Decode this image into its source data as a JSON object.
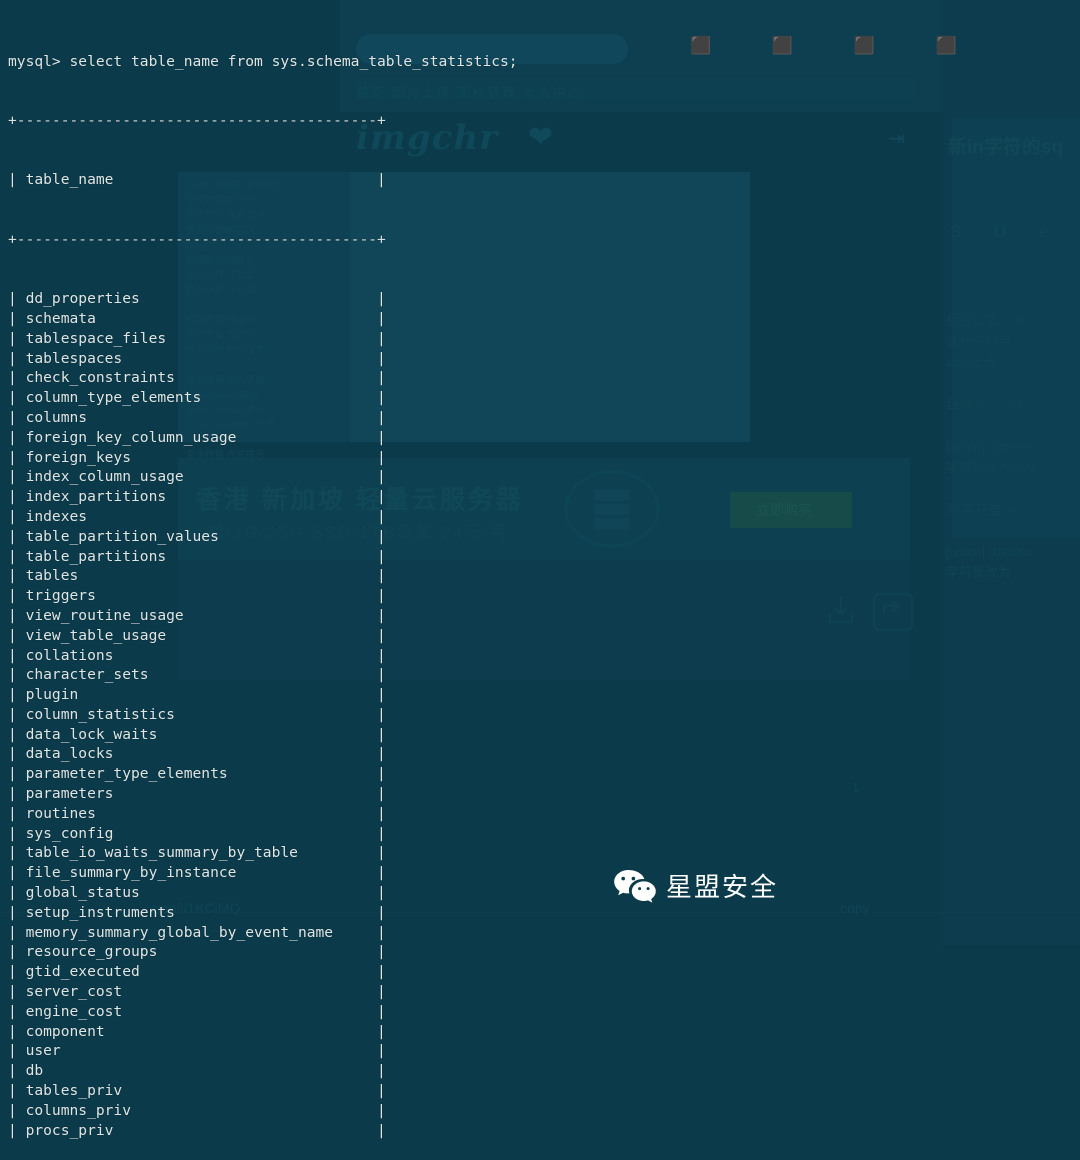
{
  "window": {
    "background_color": "#0b3a4a",
    "terminal_text_color": "#dfe6e6"
  },
  "terminal": {
    "prompt": "mysql>",
    "command": "select table_name from sys.schema_table_statistics;",
    "prompt_line": "mysql> select table_name from sys.schema_table_statistics;",
    "rule_top": "+-----------------------------------------+",
    "rule_mid": "+-----------------------------------------+",
    "column_header": "| table_name                              |",
    "column_name": "table_name",
    "rows": [
      "dd_properties",
      "schemata",
      "tablespace_files",
      "tablespaces",
      "check_constraints",
      "column_type_elements",
      "columns",
      "foreign_key_column_usage",
      "foreign_keys",
      "index_column_usage",
      "index_partitions",
      "indexes",
      "table_partition_values",
      "table_partitions",
      "tables",
      "triggers",
      "view_routine_usage",
      "view_table_usage",
      "collations",
      "character_sets",
      "plugin",
      "column_statistics",
      "data_lock_waits",
      "data_locks",
      "parameter_type_elements",
      "parameters",
      "routines",
      "sys_config",
      "table_io_waits_summary_by_table",
      "file_summary_by_instance",
      "global_status",
      "setup_instruments",
      "memory_summary_global_by_event_name",
      "resource_groups",
      "gtid_executed",
      "server_cost",
      "engine_cost",
      "component",
      "user",
      "db",
      "tables_priv",
      "columns_priv",
      "procs_priv"
    ]
  },
  "watermark": {
    "wechat_label": "星盟安全",
    "wechat_icon": "wechat-icon"
  },
  "background_ghost": {
    "site_logo": "imgchr",
    "heart_icon": "heart-icon",
    "logout_icon": "logout-icon",
    "top_nav": "首页    图片上传    图片管理             个人中心",
    "top_icons": "⬛ ⬛ ⬛ ⬛",
    "ad_title": "香港 新加坡 轻量云服务器",
    "ad_subtitle": "1核/1G/25G SSD/1TB流量  24元/月",
    "ad_button_label": "立即购买",
    "side_heading": "新in字符的sq",
    "side_icons": "S  U  e  m",
    "side_block": "后台以及 一句\n话号码利用\nlogo上传\n\n目录 /一 - sys\n\n[union] (bitwise\n字符集改为pwd\n\n别 字符里 sq\n\n[union] (bitwise\n字符集改为",
    "panel_lines_left": "select 数据库 查询语句\n显示数据库 列表\n用户权限 信息查询\n当前数据库 查询\n\n数据表 结构信息\n字段名称 与类型\n索引信息 与约束\n\n权限表 查询语句\n系统变量 与状态\n性能视图 统计信息\n\n查询结果 输出表格\nshow tables 查询\nshow schema 查询\nshow databases 列表\n\n查询数据 完成提示",
    "panel_lines_right": "mysql\n\n\nsys 库\n\n统计\n\nschema\n\n视图\n\nperformance",
    "copyright_label": "copy",
    "short_url": "com/i/1KCjMQ",
    "qr_number": "1"
  }
}
